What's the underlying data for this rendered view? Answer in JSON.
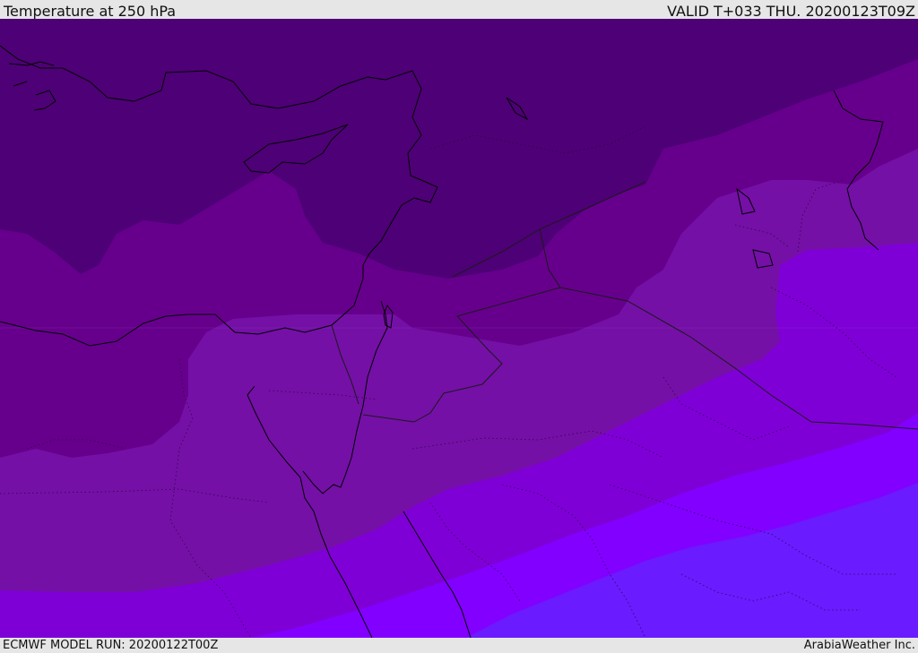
{
  "header": {
    "title": "Temperature at 250 hPa",
    "valid": "VALID T+033 THU. 20200123T09Z"
  },
  "footer": {
    "model_run": "ECMWF MODEL RUN: 20200122T00Z",
    "credit": "ArabiaWeather Inc."
  },
  "map": {
    "field": "temperature",
    "level_hpa": 250,
    "palette": [
      "#4e0076",
      "#5a0080",
      "#66008c",
      "#7410a6",
      "#7f00d6",
      "#8200ff",
      "#6a1bff"
    ],
    "coastline_color": "#000000",
    "border_color": "#1a1a1a"
  }
}
